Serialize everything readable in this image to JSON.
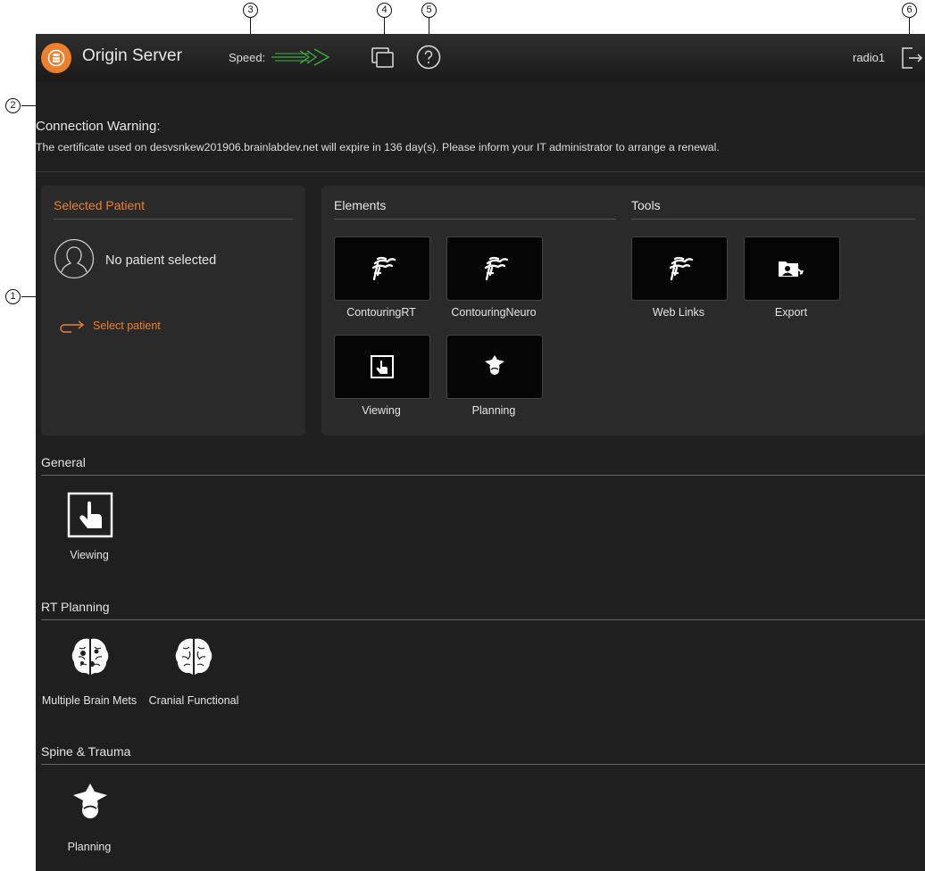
{
  "callouts": [
    "1",
    "2",
    "3",
    "4",
    "5",
    "6"
  ],
  "header": {
    "app_title": "Origin Server",
    "speed_label": "Speed:",
    "user": "radio1",
    "accent_color": "#ee7f2d",
    "speed_color": "#3cb043"
  },
  "warning": {
    "title": "Connection Warning:",
    "text": "The certificate used on desvsnkew201906.brainlabdev.net will expire in 136 day(s). Please inform your IT administrator to arrange a renewal."
  },
  "patient_panel": {
    "title": "Selected Patient",
    "status": "No patient selected",
    "select_link": "Select patient"
  },
  "elements": {
    "title": "Elements",
    "items": [
      {
        "label": "ContouringRT",
        "icon": "contouring-icon"
      },
      {
        "label": "ContouringNeuro",
        "icon": "contouring-icon"
      },
      {
        "label": "Viewing",
        "icon": "viewing-icon"
      },
      {
        "label": "Planning",
        "icon": "spine-icon"
      }
    ]
  },
  "tools": {
    "title": "Tools",
    "items": [
      {
        "label": "Web Links",
        "icon": "contouring-icon"
      },
      {
        "label": "Export",
        "icon": "export-icon"
      }
    ]
  },
  "sections": [
    {
      "title": "General",
      "items": [
        {
          "label": "Viewing",
          "icon": "viewing-icon"
        }
      ]
    },
    {
      "title": "RT Planning",
      "items": [
        {
          "label": "Multiple Brain Mets",
          "icon": "brain-mets-icon"
        },
        {
          "label": "Cranial Functional",
          "icon": "brain-icon"
        }
      ]
    },
    {
      "title": "Spine & Trauma",
      "items": [
        {
          "label": "Planning",
          "icon": "spine-icon"
        }
      ]
    }
  ]
}
